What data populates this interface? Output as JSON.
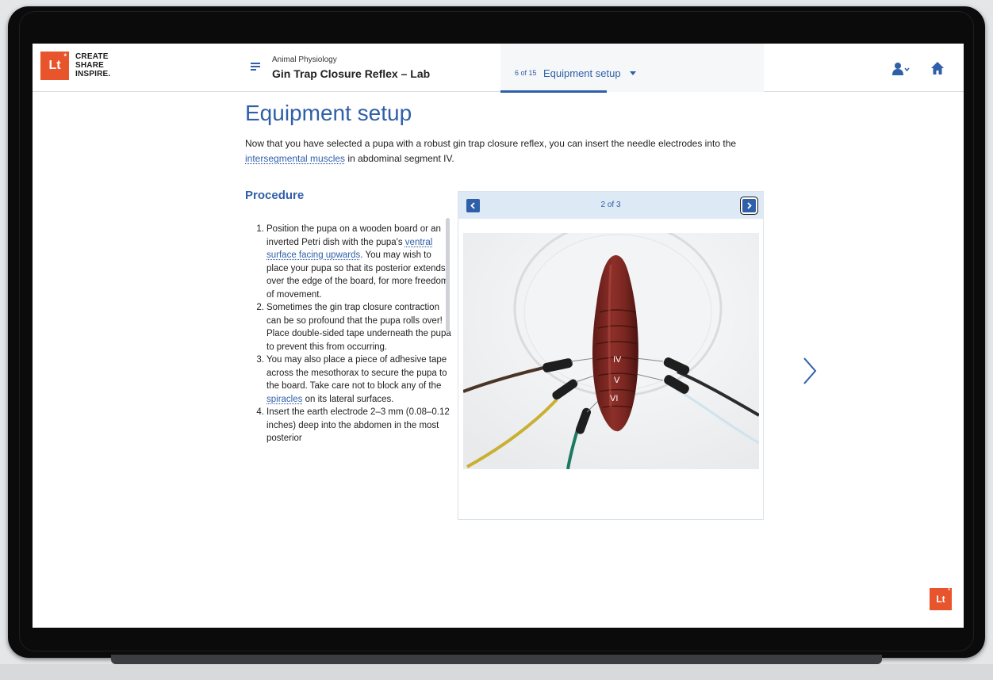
{
  "brand": {
    "logo_text": "Lt",
    "tagline_lines": [
      "CREATE",
      "SHARE",
      "INSPIRE."
    ]
  },
  "header": {
    "course_subtitle": "Animal Physiology",
    "course_title": "Gin Trap Closure Reflex – Lab",
    "section_count": "6 of 15",
    "section_name": "Equipment setup"
  },
  "page": {
    "title": "Equipment setup",
    "intro_text_1": "Now that you have selected a pupa with a robust gin trap closure reflex, you can insert the needle electrodes into the ",
    "intro_link": "intersegmental muscles",
    "intro_text_2": " in abdominal segment IV.",
    "procedure_heading": "Procedure"
  },
  "steps": [
    {
      "num": "1.",
      "pre": "Position the pupa on a wooden board or an inverted Petri dish with the pupa's ",
      "link": "ventral surface facing upwards",
      "post": ". You may wish to place your pupa so that its posterior extends over the edge of the board, for more freedom of movement."
    },
    {
      "num": "2.",
      "pre": "Sometimes the gin trap closure contraction can be so profound that the pupa rolls over! Place double-sided tape underneath the pupa to prevent this from occurring.",
      "link": "",
      "post": ""
    },
    {
      "num": "3.",
      "pre": "You may also place a piece of adhesive tape across the mesothorax to secure the pupa to the board. Take care not to block any of the ",
      "link": "spiracles",
      "post": " on its lateral surfaces."
    },
    {
      "num": "4.",
      "pre": "Insert the earth electrode 2–3 mm (0.08–0.12 inches) deep into the abdomen in the most posterior",
      "link": "",
      "post": ""
    }
  ],
  "carousel": {
    "counter": "2 of 3",
    "segment_labels": [
      "IV",
      "V",
      "VI"
    ]
  },
  "badge": {
    "logo_text": "Lt"
  },
  "colors": {
    "accent_blue": "#2f5fa8",
    "brand_orange": "#e8542b",
    "carousel_bar": "#dde9f4"
  },
  "icons": {
    "menu": "menu-icon",
    "user": "user-icon",
    "home": "home-icon",
    "prev": "chevron-left-icon",
    "next": "chevron-right-icon"
  }
}
